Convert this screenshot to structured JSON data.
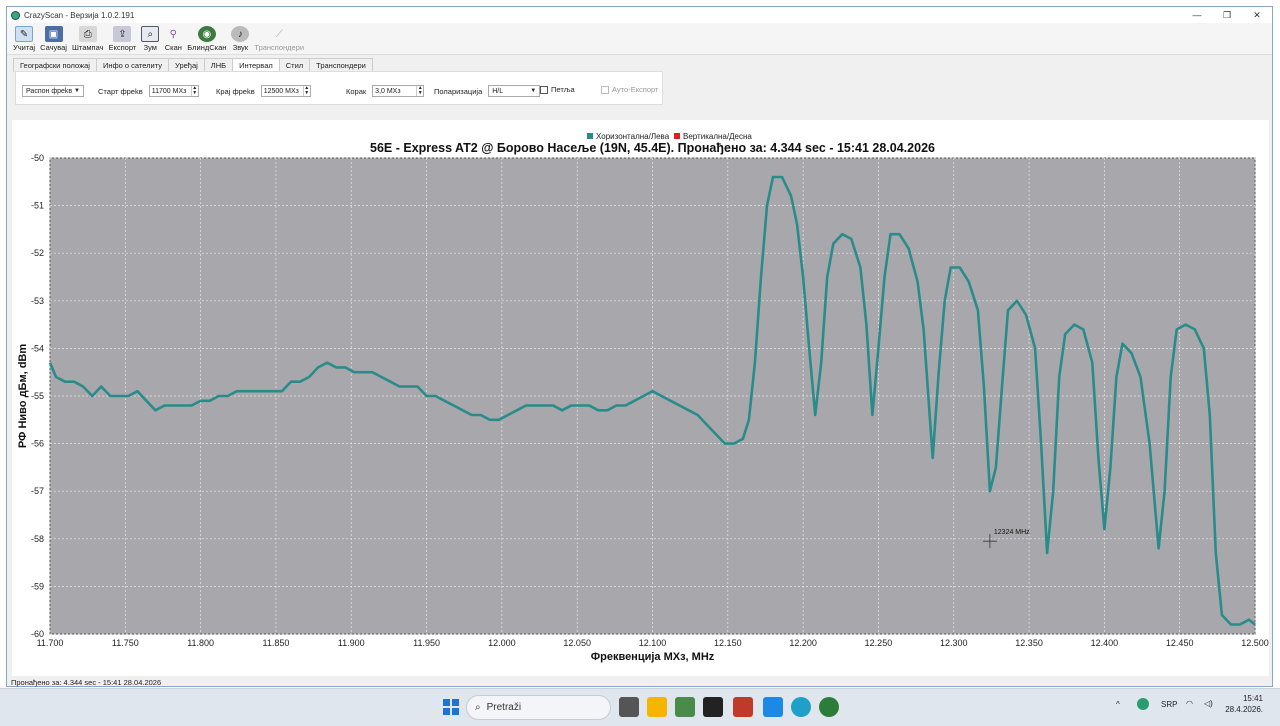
{
  "window": {
    "title": "CrazyScan - Верзија 1.0.2.191",
    "controls": [
      "—",
      "❐",
      "✕"
    ]
  },
  "toolbar": [
    {
      "label": "Учитај",
      "icon": "open-icon",
      "enabled": true
    },
    {
      "label": "Сачувај",
      "icon": "save-icon",
      "enabled": true
    },
    {
      "label": "Штампач",
      "icon": "printer-icon",
      "enabled": true
    },
    {
      "label": "Експорт",
      "icon": "export-icon",
      "enabled": true
    },
    {
      "label": "Зум",
      "icon": "zoom-icon",
      "enabled": true
    },
    {
      "label": "Скан",
      "icon": "scan-icon",
      "enabled": true
    },
    {
      "label": "БлиндСкан",
      "icon": "blindscan-icon",
      "enabled": true
    },
    {
      "label": "Звук",
      "icon": "sound-icon",
      "enabled": true
    },
    {
      "label": "Транспондери",
      "icon": "transponders-icon",
      "enabled": false
    }
  ],
  "tabs": [
    "Географски положај",
    "Инфо о сателиту",
    "Уређај",
    "ЛНБ",
    "Интервал",
    "Стил",
    "Транспондери"
  ],
  "active_tab": "Интервал",
  "interval": {
    "range_select": "Распон фреkв",
    "start_label": "Старт фреkв",
    "start_value": "11700 MXз",
    "end_label": "Крај фреkв",
    "end_value": "12500 MXз",
    "step_label": "Корак",
    "step_value": "3,0 MXз",
    "pol_label": "Поларизација",
    "pol_value": "H/L",
    "loop_label": "Петља",
    "autoexport_label": "Ауто-Експорт"
  },
  "colors": {
    "series_h": "#2a8c8a",
    "series_v": "#e02020",
    "plot_bg": "#a8a8ac"
  },
  "cursor_label": "12324 MHz",
  "status": "Пронађено за: 4.344 sec - 15:41 28.04.2026",
  "taskbar": {
    "search": "Pretraži",
    "lang": "SRP",
    "time": "15:41",
    "date": "28.4.2026."
  },
  "chart_data": {
    "type": "line",
    "title": "56E - Express AT2 @ Борово Насеље (19N, 45.4E). Пронађено за: 4.344 sec - 15:41 28.04.2026",
    "xlabel": "Фреквенција  MXз, MHz",
    "ylabel": "РФ Ниво дБм, dBm",
    "xlim": [
      11.7,
      12.5
    ],
    "ylim": [
      -60,
      -50
    ],
    "xticks": [
      "11.700",
      "11.750",
      "11.800",
      "11.850",
      "11.900",
      "11.950",
      "12.000",
      "12.050",
      "12.100",
      "12.150",
      "12.200",
      "12.250",
      "12.300",
      "12.350",
      "12.400",
      "12.450",
      "12.500"
    ],
    "yticks": [
      "-50",
      "-51",
      "-52",
      "-53",
      "-54",
      "-55",
      "-56",
      "-57",
      "-58",
      "-59",
      "-60"
    ],
    "grid": true,
    "legend": [
      "Хоризонтална/Лева",
      "Вертикална/Десна"
    ],
    "legend_position": "top",
    "series": [
      {
        "name": "Хоризонтална/Лева",
        "points": [
          [
            11.7,
            -54.3
          ],
          [
            11.704,
            -54.6
          ],
          [
            11.71,
            -54.7
          ],
          [
            11.716,
            -54.7
          ],
          [
            11.722,
            -54.8
          ],
          [
            11.728,
            -55.0
          ],
          [
            11.734,
            -54.8
          ],
          [
            11.74,
            -55.0
          ],
          [
            11.746,
            -55.0
          ],
          [
            11.752,
            -55.0
          ],
          [
            11.758,
            -54.9
          ],
          [
            11.764,
            -55.1
          ],
          [
            11.77,
            -55.3
          ],
          [
            11.776,
            -55.2
          ],
          [
            11.782,
            -55.2
          ],
          [
            11.788,
            -55.2
          ],
          [
            11.794,
            -55.2
          ],
          [
            11.8,
            -55.1
          ],
          [
            11.806,
            -55.1
          ],
          [
            11.812,
            -55.0
          ],
          [
            11.818,
            -55.0
          ],
          [
            11.824,
            -54.9
          ],
          [
            11.83,
            -54.9
          ],
          [
            11.836,
            -54.9
          ],
          [
            11.842,
            -54.9
          ],
          [
            11.848,
            -54.9
          ],
          [
            11.854,
            -54.9
          ],
          [
            11.86,
            -54.7
          ],
          [
            11.866,
            -54.7
          ],
          [
            11.872,
            -54.6
          ],
          [
            11.878,
            -54.4
          ],
          [
            11.884,
            -54.3
          ],
          [
            11.89,
            -54.4
          ],
          [
            11.896,
            -54.4
          ],
          [
            11.902,
            -54.5
          ],
          [
            11.908,
            -54.5
          ],
          [
            11.914,
            -54.5
          ],
          [
            11.92,
            -54.6
          ],
          [
            11.926,
            -54.7
          ],
          [
            11.932,
            -54.8
          ],
          [
            11.938,
            -54.8
          ],
          [
            11.944,
            -54.8
          ],
          [
            11.95,
            -55.0
          ],
          [
            11.956,
            -55.0
          ],
          [
            11.962,
            -55.1
          ],
          [
            11.968,
            -55.2
          ],
          [
            11.974,
            -55.3
          ],
          [
            11.98,
            -55.4
          ],
          [
            11.986,
            -55.4
          ],
          [
            11.992,
            -55.5
          ],
          [
            11.998,
            -55.5
          ],
          [
            12.004,
            -55.4
          ],
          [
            12.01,
            -55.3
          ],
          [
            12.016,
            -55.2
          ],
          [
            12.022,
            -55.2
          ],
          [
            12.028,
            -55.2
          ],
          [
            12.034,
            -55.2
          ],
          [
            12.04,
            -55.3
          ],
          [
            12.046,
            -55.2
          ],
          [
            12.052,
            -55.2
          ],
          [
            12.058,
            -55.2
          ],
          [
            12.064,
            -55.3
          ],
          [
            12.07,
            -55.3
          ],
          [
            12.076,
            -55.2
          ],
          [
            12.082,
            -55.2
          ],
          [
            12.088,
            -55.1
          ],
          [
            12.094,
            -55.0
          ],
          [
            12.1,
            -54.9
          ],
          [
            12.106,
            -55.0
          ],
          [
            12.112,
            -55.1
          ],
          [
            12.118,
            -55.2
          ],
          [
            12.124,
            -55.3
          ],
          [
            12.13,
            -55.4
          ],
          [
            12.136,
            -55.6
          ],
          [
            12.142,
            -55.8
          ],
          [
            12.148,
            -56.0
          ],
          [
            12.154,
            -56.0
          ],
          [
            12.16,
            -55.9
          ],
          [
            12.164,
            -55.5
          ],
          [
            12.168,
            -54.3
          ],
          [
            12.172,
            -52.5
          ],
          [
            12.176,
            -51.0
          ],
          [
            12.18,
            -50.4
          ],
          [
            12.186,
            -50.4
          ],
          [
            12.192,
            -50.8
          ],
          [
            12.196,
            -51.4
          ],
          [
            12.2,
            -52.5
          ],
          [
            12.204,
            -54.0
          ],
          [
            12.208,
            -55.4
          ],
          [
            12.212,
            -54.3
          ],
          [
            12.216,
            -52.5
          ],
          [
            12.22,
            -51.8
          ],
          [
            12.226,
            -51.6
          ],
          [
            12.232,
            -51.7
          ],
          [
            12.238,
            -52.3
          ],
          [
            12.242,
            -53.5
          ],
          [
            12.246,
            -55.4
          ],
          [
            12.25,
            -54.0
          ],
          [
            12.254,
            -52.5
          ],
          [
            12.258,
            -51.6
          ],
          [
            12.264,
            -51.6
          ],
          [
            12.27,
            -51.9
          ],
          [
            12.276,
            -52.6
          ],
          [
            12.28,
            -53.6
          ],
          [
            12.286,
            -56.3
          ],
          [
            12.29,
            -54.5
          ],
          [
            12.294,
            -53.0
          ],
          [
            12.298,
            -52.3
          ],
          [
            12.304,
            -52.3
          ],
          [
            12.31,
            -52.6
          ],
          [
            12.316,
            -53.2
          ],
          [
            12.32,
            -54.8
          ],
          [
            12.324,
            -57.0
          ],
          [
            12.328,
            -56.5
          ],
          [
            12.332,
            -54.8
          ],
          [
            12.336,
            -53.2
          ],
          [
            12.342,
            -53.0
          ],
          [
            12.348,
            -53.3
          ],
          [
            12.354,
            -54.0
          ],
          [
            12.358,
            -56.0
          ],
          [
            12.362,
            -58.3
          ],
          [
            12.366,
            -57.0
          ],
          [
            12.37,
            -54.6
          ],
          [
            12.374,
            -53.7
          ],
          [
            12.38,
            -53.5
          ],
          [
            12.386,
            -53.6
          ],
          [
            12.392,
            -54.3
          ],
          [
            12.396,
            -56.3
          ],
          [
            12.4,
            -57.8
          ],
          [
            12.404,
            -56.5
          ],
          [
            12.408,
            -54.6
          ],
          [
            12.412,
            -53.9
          ],
          [
            12.418,
            -54.1
          ],
          [
            12.424,
            -54.6
          ],
          [
            12.43,
            -56.0
          ],
          [
            12.436,
            -58.2
          ],
          [
            12.44,
            -57.0
          ],
          [
            12.444,
            -54.6
          ],
          [
            12.448,
            -53.6
          ],
          [
            12.454,
            -53.5
          ],
          [
            12.46,
            -53.6
          ],
          [
            12.466,
            -54.0
          ],
          [
            12.47,
            -55.4
          ],
          [
            12.474,
            -58.3
          ],
          [
            12.478,
            -59.6
          ],
          [
            12.484,
            -59.8
          ],
          [
            12.49,
            -59.8
          ],
          [
            12.496,
            -59.7
          ],
          [
            12.5,
            -59.8
          ]
        ]
      }
    ]
  }
}
